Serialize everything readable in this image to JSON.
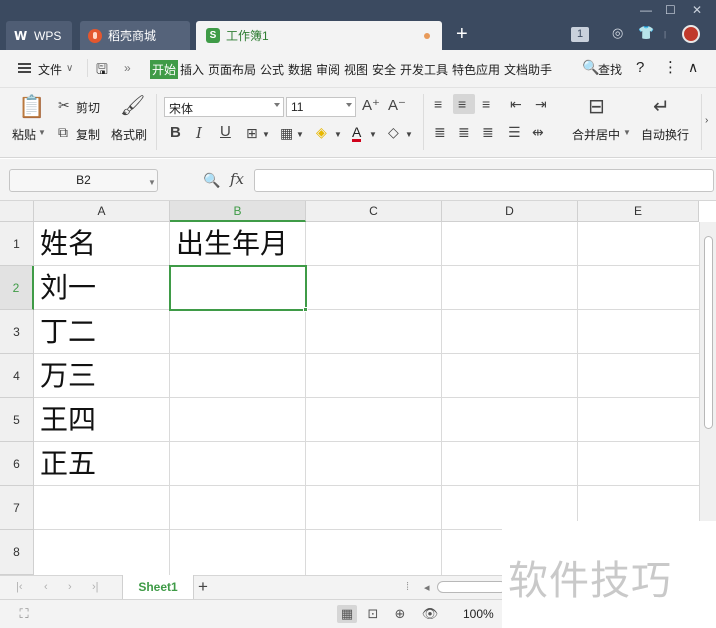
{
  "titlebar": {
    "tabs": [
      {
        "label": "WPS",
        "icon": "wps-logo"
      },
      {
        "label": "稻壳商城",
        "icon": "daoke-logo"
      },
      {
        "label": "工作簿1",
        "icon": "sheet-logo",
        "modified": true
      }
    ],
    "new_tab": "+",
    "badge_count": "1",
    "accent_color": "#3b4a60"
  },
  "menubar": {
    "file_label": "文件",
    "tabs": [
      "开始",
      "插入",
      "页面布局",
      "公式",
      "数据",
      "审阅",
      "视图",
      "安全",
      "开发工具",
      "特色应用",
      "文档助手"
    ],
    "active_tab": "开始",
    "search_label": "查找",
    "active_color": "#3f9b47"
  },
  "ribbon": {
    "paste_label": "粘贴",
    "cut_label": "剪切",
    "copy_label": "复制",
    "format_painter_label": "格式刷",
    "font_name": "宋体",
    "font_size": "11",
    "bold": "B",
    "italic": "I",
    "underline": "U",
    "merge_center_label": "合并居中",
    "wrap_text_label": "自动换行"
  },
  "formula_bar": {
    "name_box": "B2",
    "fx_label": "fx",
    "formula_value": ""
  },
  "sheet": {
    "columns": [
      "A",
      "B",
      "C",
      "D",
      "E"
    ],
    "rows": [
      "1",
      "2",
      "3",
      "4",
      "5",
      "6",
      "7",
      "8"
    ],
    "active_cell": "B2",
    "active_column": "B",
    "active_row": "2",
    "cells": {
      "A1": "姓名",
      "B1": "出生年月",
      "A2": "刘一",
      "A3": "丁二",
      "A4": "万三",
      "A5": "王四",
      "A6": "正五"
    }
  },
  "sheet_tabs": {
    "tabs": [
      "Sheet1"
    ],
    "active": "Sheet1",
    "add_label": "+"
  },
  "status_bar": {
    "zoom": "100%"
  },
  "watermark": {
    "text": "软件技巧"
  }
}
